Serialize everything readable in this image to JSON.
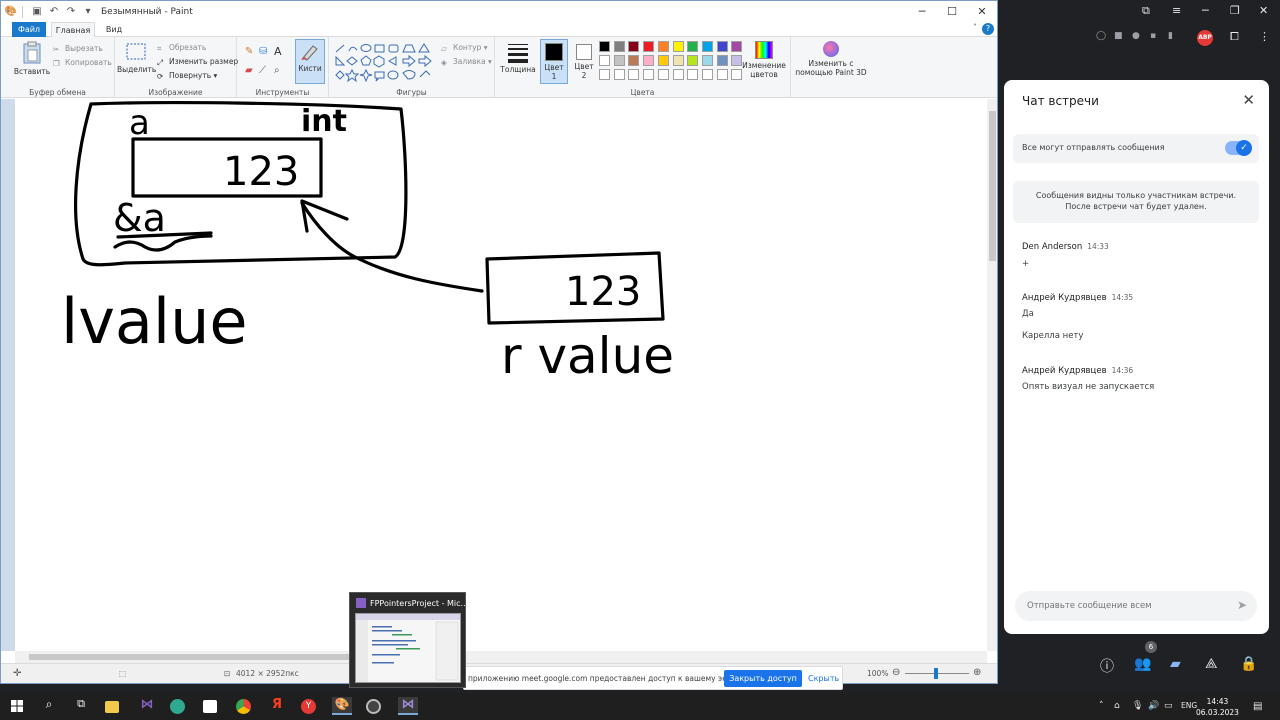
{
  "paint": {
    "title": "Безымянный - Paint",
    "tabs": {
      "file": "Файл",
      "home": "Главная",
      "view": "Вид"
    },
    "clipboard": {
      "paste": "Вставить",
      "cut": "Вырезать",
      "copy": "Копировать",
      "group": "Буфер обмена"
    },
    "image": {
      "select": "Выделить",
      "crop": "Обрезать",
      "resize": "Изменить размер",
      "rotate": "Повернуть",
      "group": "Изображение"
    },
    "tools": {
      "group": "Инструменты",
      "brushes": "Кисти"
    },
    "shapes": {
      "outline": "Контур",
      "fill": "Заливка",
      "group": "Фигуры"
    },
    "thickness": "Толщина",
    "color1": "Цвет 1",
    "color2": "Цвет 2",
    "colors_group": "Цвета",
    "edit_colors": "Изменение цветов",
    "paint3d": "Изменить с помощью Paint 3D",
    "palette": [
      "#000000",
      "#7f7f7f",
      "#880015",
      "#ed1c24",
      "#ff7f27",
      "#fff200",
      "#22b14c",
      "#00a2e8",
      "#3f48cc",
      "#a349a4",
      "#ffffff",
      "#c3c3c3",
      "#b97a57",
      "#ffaec9",
      "#ffc90e",
      "#efe4b0",
      "#b5e61d",
      "#99d9ea",
      "#7092be",
      "#c8bfe7"
    ],
    "status": {
      "dimensions": "4012 × 2952пкс",
      "zoom": "100%"
    },
    "drawing": {
      "labels": [
        "a",
        "int",
        "123",
        "&a",
        "lvalue",
        "123",
        "r value"
      ]
    }
  },
  "chat": {
    "title": "Чат встречи",
    "permission_label": "Все могут отправлять сообщения",
    "notice_line1": "Сообщения видны только участникам встречи.",
    "notice_line2": "После встречи чат будет удален.",
    "messages": [
      {
        "author": "Den Anderson",
        "time": "14:33",
        "lines": [
          "+"
        ]
      },
      {
        "author": "Андрей Кудрявцев",
        "time": "14:35",
        "lines": [
          "Да",
          "Карелла нету"
        ]
      },
      {
        "author": "Андрей Кудрявцев",
        "time": "14:36",
        "lines": [
          "Опять визуал не запускается"
        ]
      }
    ],
    "input_placeholder": "Отправьте сообщение всем",
    "people_count": "6"
  },
  "share": {
    "text": "приложению meet.google.com предоставлен доступ к вашему экрану.",
    "stop": "Закрыть доступ",
    "hide": "Скрыть"
  },
  "preview": {
    "title": "FPPointersProject - Mic..."
  },
  "taskbar": {
    "lang": "ENG",
    "time": "14:43",
    "date": "06.03.2023"
  },
  "browser": {
    "abp": "ABP"
  }
}
